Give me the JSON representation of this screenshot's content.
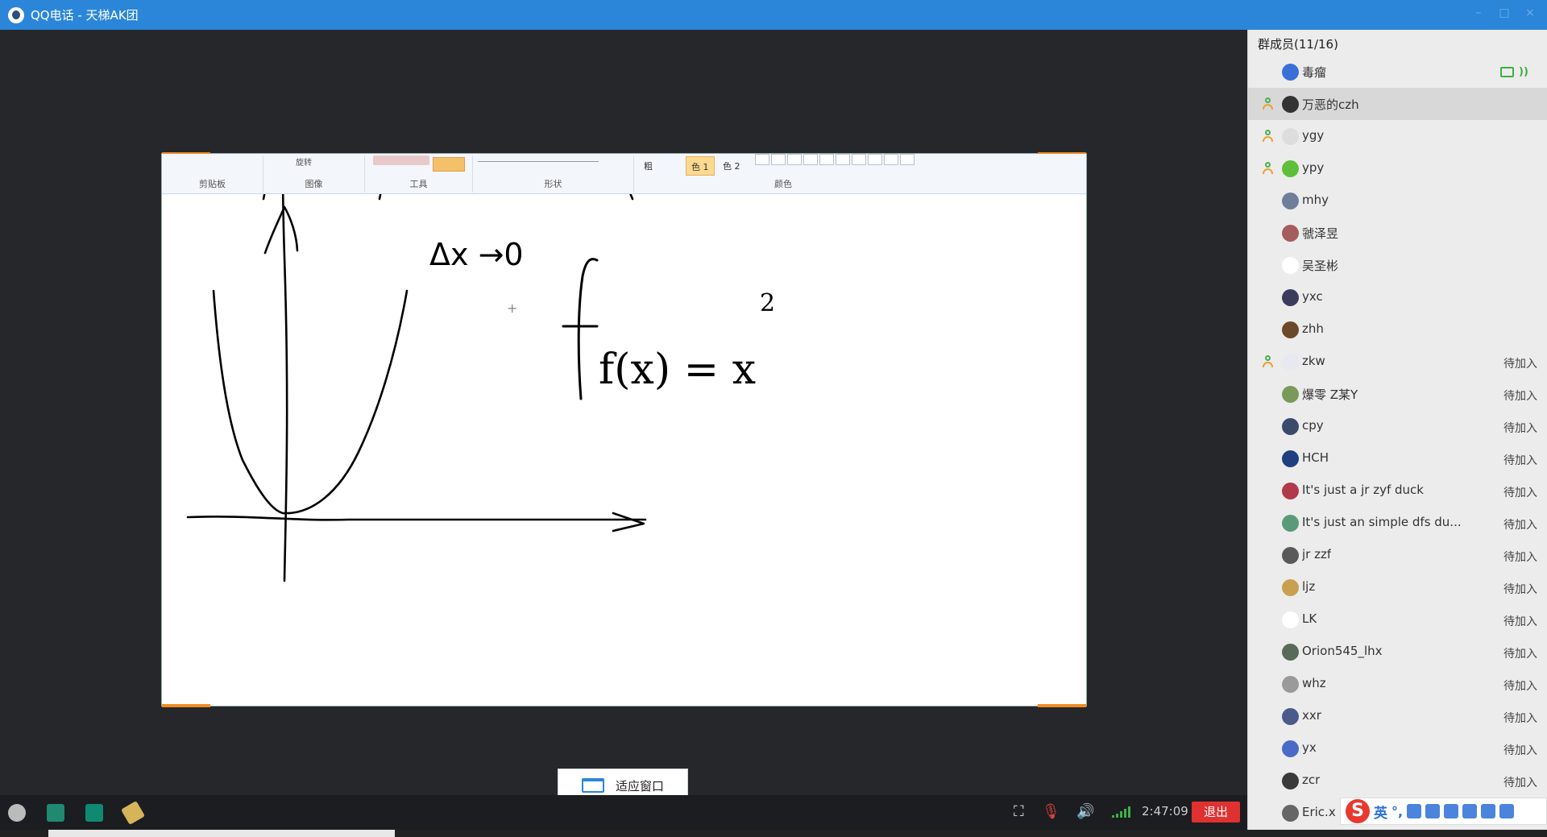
{
  "window": {
    "title": "QQ电话 - 天梯AK团"
  },
  "ribbon": {
    "groups": [
      "剪贴板",
      "图像",
      "工具",
      "形状",
      "颜色"
    ],
    "rotate_label": "旋转",
    "thickness_label": "粗",
    "color1_label": "色 1",
    "color2_label": "色 2"
  },
  "whiteboard": {
    "formula_limit": "Δx →0",
    "formula_func": "f(x) = x",
    "formula_exp": "2"
  },
  "fit_window_button": {
    "label": "适应窗口"
  },
  "members_panel": {
    "header": "群成员(11/16)",
    "status_pending": "待加入",
    "members": [
      {
        "name": "毒瘤",
        "status": "",
        "speaking": true,
        "host_icon": false,
        "avatar_color": "#3a6fd8",
        "selected": false
      },
      {
        "name": "万恶的czh",
        "status": "",
        "speaking": false,
        "host_icon": true,
        "avatar_color": "#333333",
        "selected": true
      },
      {
        "name": "ygy",
        "status": "",
        "speaking": false,
        "host_icon": true,
        "avatar_color": "#dddddd",
        "selected": false
      },
      {
        "name": "ypy",
        "status": "",
        "speaking": false,
        "host_icon": true,
        "avatar_color": "#5fbf3a",
        "selected": false
      },
      {
        "name": "mhy",
        "status": "",
        "speaking": false,
        "host_icon": false,
        "avatar_color": "#6f7f99",
        "selected": false
      },
      {
        "name": "虢泽昱",
        "status": "",
        "speaking": false,
        "host_icon": false,
        "avatar_color": "#a45c5c",
        "selected": false
      },
      {
        "name": "吴圣彬",
        "status": "",
        "speaking": false,
        "host_icon": false,
        "avatar_color": "#ffffff",
        "selected": false
      },
      {
        "name": "yxc",
        "status": "",
        "speaking": false,
        "host_icon": false,
        "avatar_color": "#3b3b5c",
        "selected": false
      },
      {
        "name": "zhh",
        "status": "",
        "speaking": false,
        "host_icon": false,
        "avatar_color": "#6b4a2a",
        "selected": false
      },
      {
        "name": "zkw",
        "status": "待加入",
        "speaking": false,
        "host_icon": true,
        "avatar_color": "#e8e8f0",
        "selected": false
      },
      {
        "name": "爆零 Z某Y",
        "status": "待加入",
        "speaking": false,
        "host_icon": false,
        "avatar_color": "#7a9a5a",
        "selected": false
      },
      {
        "name": "cpy",
        "status": "待加入",
        "speaking": false,
        "host_icon": false,
        "avatar_color": "#3a4a6a",
        "selected": false
      },
      {
        "name": "HCH",
        "status": "待加入",
        "speaking": false,
        "host_icon": false,
        "avatar_color": "#1f3f7f",
        "selected": false
      },
      {
        "name": "It's just a jr zyf duck",
        "status": "待加入",
        "speaking": false,
        "host_icon": false,
        "avatar_color": "#b03a4a",
        "selected": false
      },
      {
        "name": "It's just an simple dfs du...",
        "status": "待加入",
        "speaking": false,
        "host_icon": false,
        "avatar_color": "#5a9a7a",
        "selected": false
      },
      {
        "name": "jr zzf",
        "status": "待加入",
        "speaking": false,
        "host_icon": false,
        "avatar_color": "#5a5a5a",
        "selected": false
      },
      {
        "name": "ljz",
        "status": "待加入",
        "speaking": false,
        "host_icon": false,
        "avatar_color": "#c8a050",
        "selected": false
      },
      {
        "name": "LK",
        "status": "待加入",
        "speaking": false,
        "host_icon": false,
        "avatar_color": "#ffffff",
        "selected": false
      },
      {
        "name": "Orion545_lhx",
        "status": "待加入",
        "speaking": false,
        "host_icon": false,
        "avatar_color": "#5a6a5a",
        "selected": false
      },
      {
        "name": "whz",
        "status": "待加入",
        "speaking": false,
        "host_icon": false,
        "avatar_color": "#9a9a9a",
        "selected": false
      },
      {
        "name": "xxr",
        "status": "待加入",
        "speaking": false,
        "host_icon": false,
        "avatar_color": "#4a5a8a",
        "selected": false
      },
      {
        "name": "yx",
        "status": "待加入",
        "speaking": false,
        "host_icon": false,
        "avatar_color": "#4a6ac8",
        "selected": false
      },
      {
        "name": "zcr",
        "status": "待加入",
        "speaking": false,
        "host_icon": false,
        "avatar_color": "#3a3a3a",
        "selected": false
      },
      {
        "name": "Eric.x",
        "status": "",
        "speaking": false,
        "host_icon": false,
        "avatar_color": "#666666",
        "selected": false
      }
    ]
  },
  "toolbar": {
    "time": "2:47:09",
    "exit_label": "退出",
    "app_icons": [
      "capture-icon",
      "whiteboard-icon",
      "share-screen-icon",
      "eraser-icon"
    ]
  },
  "ime": {
    "logo_text": "S",
    "lang_label": "英",
    "punct_label": "°,"
  },
  "colors": {
    "titlebar": "#2b86d9",
    "exit": "#e03131",
    "accent_orange": "#f08a24",
    "pending_text": "#444444"
  }
}
